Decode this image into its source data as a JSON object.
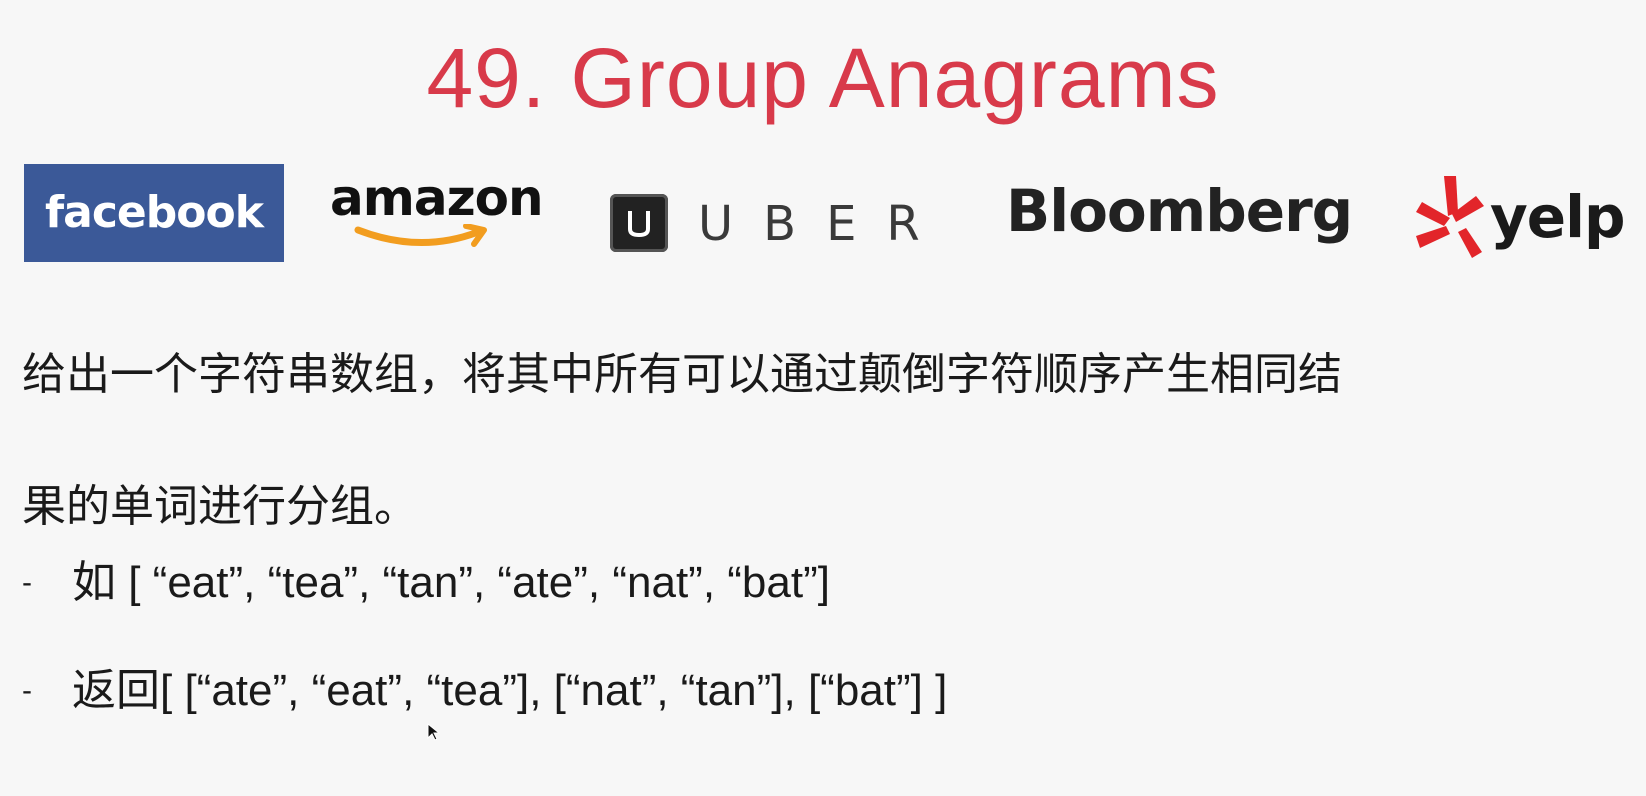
{
  "slide": {
    "title": "49. Group Anagrams",
    "logos": [
      {
        "name": "facebook",
        "text": "facebook",
        "color": "#3b5998"
      },
      {
        "name": "amazon",
        "text": "amazon",
        "accent": "#f29d1f"
      },
      {
        "name": "uber",
        "text": "UBER",
        "color": "#222222"
      },
      {
        "name": "bloomberg",
        "text": "Bloomberg"
      },
      {
        "name": "yelp",
        "text": "yelp",
        "accent": "#e2252a"
      }
    ],
    "description": {
      "line1": "给出一个字符串数组，将其中所有可以通过颠倒字符顺序产生相同结",
      "line2": "果的单词进行分组。"
    },
    "bullets": [
      {
        "dash": "-",
        "text": "如 [ “eat”, “tea”, “tan”, “ate”, “nat”, “bat”]"
      },
      {
        "dash": "-",
        "text": "返回[ [“ate”, “eat”, “tea”], [“nat”, “tan”], [“bat”] ]"
      }
    ],
    "title_color": "#d83a4a"
  }
}
